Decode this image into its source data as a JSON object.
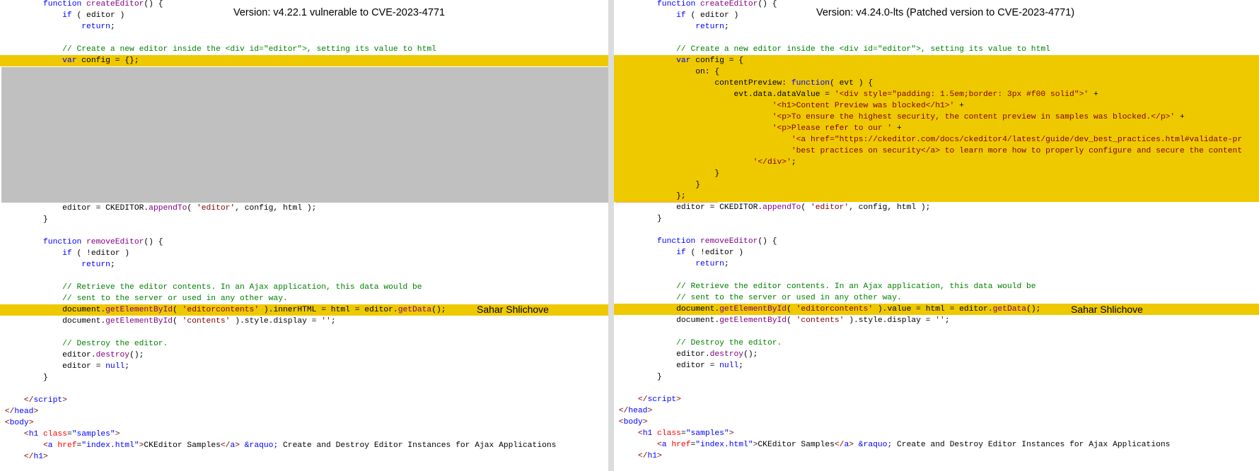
{
  "left_pane": {
    "banner": "Version: v4.22.1 vulnerable to CVE-2023-4771",
    "signature": "Sahar Shlichove",
    "lines": [
      {
        "indent": "        ",
        "tokens": [
          [
            "kw",
            "function "
          ],
          [
            "fn",
            "createEditor"
          ],
          [
            "plain",
            "() {"
          ]
        ]
      },
      {
        "indent": "            ",
        "tokens": [
          [
            "kw",
            "if "
          ],
          [
            "plain",
            "( editor )"
          ]
        ]
      },
      {
        "indent": "                ",
        "tokens": [
          [
            "kw",
            "return"
          ],
          [
            "plain",
            ";"
          ]
        ]
      },
      {
        "indent": "",
        "tokens": []
      },
      {
        "indent": "            ",
        "tokens": [
          [
            "cmt",
            "// Create a new editor inside the <div id=\"editor\">, setting its value to html"
          ]
        ]
      },
      {
        "indent": "            ",
        "tokens": [
          [
            "kw",
            "var "
          ],
          [
            "plain",
            "config = {};"
          ]
        ],
        "hl": "yellow"
      },
      {
        "indent": "            ",
        "tokens": [
          [
            "plain",
            "editor = "
          ],
          [
            "plain",
            "CKEDITOR."
          ],
          [
            "fn",
            "appendTo"
          ],
          [
            "plain",
            "( "
          ],
          [
            "str",
            "'editor'"
          ],
          [
            "plain",
            ", config, html );"
          ]
        ]
      },
      {
        "indent": "        ",
        "tokens": [
          [
            "plain",
            "}"
          ]
        ]
      },
      {
        "indent": "",
        "tokens": []
      },
      {
        "indent": "        ",
        "tokens": [
          [
            "kw",
            "function "
          ],
          [
            "fn",
            "removeEditor"
          ],
          [
            "plain",
            "() {"
          ]
        ]
      },
      {
        "indent": "            ",
        "tokens": [
          [
            "kw",
            "if "
          ],
          [
            "plain",
            "( !editor )"
          ]
        ]
      },
      {
        "indent": "                ",
        "tokens": [
          [
            "kw",
            "return"
          ],
          [
            "plain",
            ";"
          ]
        ]
      },
      {
        "indent": "",
        "tokens": []
      },
      {
        "indent": "            ",
        "tokens": [
          [
            "cmt",
            "// Retrieve the editor contents. In an Ajax application, this data would be"
          ]
        ]
      },
      {
        "indent": "            ",
        "tokens": [
          [
            "cmt",
            "// sent to the server or used in any other way."
          ]
        ]
      },
      {
        "indent": "            ",
        "tokens": [
          [
            "plain",
            "document."
          ],
          [
            "fn",
            "getElementById"
          ],
          [
            "plain",
            "( "
          ],
          [
            "str",
            "'editorcontents'"
          ],
          [
            "plain",
            " )."
          ],
          [
            "plain",
            "innerHTML"
          ],
          [
            "plain",
            " = html = editor."
          ],
          [
            "fn",
            "getData"
          ],
          [
            "plain",
            "();"
          ]
        ],
        "hl": "yellow"
      },
      {
        "indent": "            ",
        "tokens": [
          [
            "plain",
            "document."
          ],
          [
            "fn",
            "getElementById"
          ],
          [
            "plain",
            "( "
          ],
          [
            "str",
            "'contents'"
          ],
          [
            "plain",
            " ).style.display = "
          ],
          [
            "str",
            "''"
          ],
          [
            "plain",
            ";"
          ]
        ]
      },
      {
        "indent": "",
        "tokens": []
      },
      {
        "indent": "            ",
        "tokens": [
          [
            "cmt",
            "// Destroy the editor."
          ]
        ]
      },
      {
        "indent": "            ",
        "tokens": [
          [
            "plain",
            "editor."
          ],
          [
            "fn",
            "destroy"
          ],
          [
            "plain",
            "();"
          ]
        ]
      },
      {
        "indent": "            ",
        "tokens": [
          [
            "plain",
            "editor = "
          ],
          [
            "kw",
            "null"
          ],
          [
            "plain",
            ";"
          ]
        ]
      },
      {
        "indent": "        ",
        "tokens": [
          [
            "plain",
            "}"
          ]
        ]
      },
      {
        "indent": "",
        "tokens": []
      },
      {
        "indent": "    ",
        "tokens": [
          [
            "tag",
            "</"
          ],
          [
            "kw",
            "script"
          ],
          [
            "tag",
            ">"
          ]
        ]
      },
      {
        "indent": "",
        "tokens": [
          [
            "tag",
            "</"
          ],
          [
            "kw",
            "head"
          ],
          [
            "tag",
            ">"
          ]
        ]
      },
      {
        "indent": "",
        "tokens": [
          [
            "tag",
            "<"
          ],
          [
            "kw",
            "body"
          ],
          [
            "tag",
            ">"
          ]
        ]
      },
      {
        "indent": "    ",
        "tokens": [
          [
            "tag",
            "<"
          ],
          [
            "kw",
            "h1 "
          ],
          [
            "attr",
            "class"
          ],
          [
            "plain",
            "="
          ],
          [
            "val",
            "\"samples\""
          ],
          [
            "tag",
            ">"
          ]
        ]
      },
      {
        "indent": "        ",
        "tokens": [
          [
            "tag",
            "<"
          ],
          [
            "kw",
            "a "
          ],
          [
            "attr",
            "href"
          ],
          [
            "plain",
            "="
          ],
          [
            "val",
            "\"index.html\""
          ],
          [
            "tag",
            ">"
          ],
          [
            "plain",
            "CKEditor Samples"
          ],
          [
            "tag",
            "</"
          ],
          [
            "kw",
            "a"
          ],
          [
            "tag",
            ">"
          ],
          [
            "plain",
            " "
          ],
          [
            "ent",
            "&raquo;"
          ],
          [
            "plain",
            " Create and Destroy Editor Instances for Ajax Applications"
          ]
        ]
      },
      {
        "indent": "    ",
        "tokens": [
          [
            "tag",
            "</"
          ],
          [
            "kw",
            "h1"
          ],
          [
            "tag",
            ">"
          ]
        ]
      }
    ]
  },
  "right_pane": {
    "banner": "Version: v4.24.0-lts (Patched version to CVE-2023-4771)",
    "signature": "Sahar Shlichove",
    "lines": [
      {
        "indent": "        ",
        "tokens": [
          [
            "kw",
            "function "
          ],
          [
            "fn",
            "createEditor"
          ],
          [
            "plain",
            "() {"
          ]
        ]
      },
      {
        "indent": "            ",
        "tokens": [
          [
            "kw",
            "if "
          ],
          [
            "plain",
            "( editor )"
          ]
        ]
      },
      {
        "indent": "                ",
        "tokens": [
          [
            "kw",
            "return"
          ],
          [
            "plain",
            ";"
          ]
        ]
      },
      {
        "indent": "",
        "tokens": []
      },
      {
        "indent": "            ",
        "tokens": [
          [
            "cmt",
            "// Create a new editor inside the <div id=\"editor\">, setting its value to html"
          ]
        ]
      },
      {
        "indent": "            ",
        "tokens": [
          [
            "kw",
            "var "
          ],
          [
            "plain",
            "config = {"
          ]
        ],
        "hl": "yellow"
      },
      {
        "indent": "                ",
        "tokens": [
          [
            "plain",
            "on: {"
          ]
        ],
        "hl": "yellow"
      },
      {
        "indent": "                    ",
        "tokens": [
          [
            "plain",
            "contentPreview: "
          ],
          [
            "kw",
            "function"
          ],
          [
            "plain",
            "( evt ) {"
          ]
        ],
        "hl": "yellow"
      },
      {
        "indent": "                        ",
        "tokens": [
          [
            "plain",
            "evt.data.dataValue = "
          ],
          [
            "str",
            "'<div style=\"padding: 1.5em;border: 3px #f00 solid\">'"
          ],
          [
            "plain",
            " +"
          ]
        ],
        "hl": "yellow"
      },
      {
        "indent": "                                ",
        "tokens": [
          [
            "str",
            "'<h1>Content Preview was blocked</h1>'"
          ],
          [
            "plain",
            " +"
          ]
        ],
        "hl": "yellow"
      },
      {
        "indent": "                                ",
        "tokens": [
          [
            "str",
            "'<p>To ensure the highest security, the content preview in samples was blocked.</p>'"
          ],
          [
            "plain",
            " +"
          ]
        ],
        "hl": "yellow"
      },
      {
        "indent": "                                ",
        "tokens": [
          [
            "str",
            "'<p>Please refer to our '"
          ],
          [
            "plain",
            " +"
          ]
        ],
        "hl": "yellow"
      },
      {
        "indent": "                                    ",
        "tokens": [
          [
            "str",
            "'<a href=\"https://ckeditor.com/docs/ckeditor4/latest/guide/dev_best_practices.html#validate-pr"
          ]
        ],
        "hl": "yellow"
      },
      {
        "indent": "                                    ",
        "tokens": [
          [
            "str",
            "'best practices on security</a> to learn more how to properly configure and secure the content"
          ]
        ],
        "hl": "yellow"
      },
      {
        "indent": "                            ",
        "tokens": [
          [
            "str",
            "'</div>'"
          ],
          [
            "plain",
            ";"
          ]
        ],
        "hl": "yellow"
      },
      {
        "indent": "                    ",
        "tokens": [
          [
            "plain",
            "}"
          ]
        ],
        "hl": "yellow"
      },
      {
        "indent": "                ",
        "tokens": [
          [
            "plain",
            "}"
          ]
        ],
        "hl": "yellow"
      },
      {
        "indent": "            ",
        "tokens": [
          [
            "plain",
            "};"
          ]
        ],
        "hl": "yellow"
      },
      {
        "indent": "            ",
        "tokens": [
          [
            "plain",
            "editor = "
          ],
          [
            "plain",
            "CKEDITOR."
          ],
          [
            "fn",
            "appendTo"
          ],
          [
            "plain",
            "( "
          ],
          [
            "str",
            "'editor'"
          ],
          [
            "plain",
            ", config, html );"
          ]
        ]
      },
      {
        "indent": "        ",
        "tokens": [
          [
            "plain",
            "}"
          ]
        ]
      },
      {
        "indent": "",
        "tokens": []
      },
      {
        "indent": "        ",
        "tokens": [
          [
            "kw",
            "function "
          ],
          [
            "fn",
            "removeEditor"
          ],
          [
            "plain",
            "() {"
          ]
        ]
      },
      {
        "indent": "            ",
        "tokens": [
          [
            "kw",
            "if "
          ],
          [
            "plain",
            "( !editor )"
          ]
        ]
      },
      {
        "indent": "                ",
        "tokens": [
          [
            "kw",
            "return"
          ],
          [
            "plain",
            ";"
          ]
        ]
      },
      {
        "indent": "",
        "tokens": []
      },
      {
        "indent": "            ",
        "tokens": [
          [
            "cmt",
            "// Retrieve the editor contents. In an Ajax application, this data would be"
          ]
        ]
      },
      {
        "indent": "            ",
        "tokens": [
          [
            "cmt",
            "// sent to the server or used in any other way."
          ]
        ]
      },
      {
        "indent": "            ",
        "tokens": [
          [
            "plain",
            "document."
          ],
          [
            "fn",
            "getElementById"
          ],
          [
            "plain",
            "( "
          ],
          [
            "str",
            "'editorcontents'"
          ],
          [
            "plain",
            " )."
          ],
          [
            "plain",
            "value"
          ],
          [
            "plain",
            " = html = editor."
          ],
          [
            "fn",
            "getData"
          ],
          [
            "plain",
            "();"
          ]
        ],
        "hl": "yellow"
      },
      {
        "indent": "            ",
        "tokens": [
          [
            "plain",
            "document."
          ],
          [
            "fn",
            "getElementById"
          ],
          [
            "plain",
            "( "
          ],
          [
            "str",
            "'contents'"
          ],
          [
            "plain",
            " ).style.display = "
          ],
          [
            "str",
            "''"
          ],
          [
            "plain",
            ";"
          ]
        ]
      },
      {
        "indent": "",
        "tokens": []
      },
      {
        "indent": "            ",
        "tokens": [
          [
            "cmt",
            "// Destroy the editor."
          ]
        ]
      },
      {
        "indent": "            ",
        "tokens": [
          [
            "plain",
            "editor."
          ],
          [
            "fn",
            "destroy"
          ],
          [
            "plain",
            "();"
          ]
        ]
      },
      {
        "indent": "            ",
        "tokens": [
          [
            "plain",
            "editor = "
          ],
          [
            "kw",
            "null"
          ],
          [
            "plain",
            ";"
          ]
        ]
      },
      {
        "indent": "        ",
        "tokens": [
          [
            "plain",
            "}"
          ]
        ]
      },
      {
        "indent": "",
        "tokens": []
      },
      {
        "indent": "    ",
        "tokens": [
          [
            "tag",
            "</"
          ],
          [
            "kw",
            "script"
          ],
          [
            "tag",
            ">"
          ]
        ]
      },
      {
        "indent": "",
        "tokens": [
          [
            "tag",
            "</"
          ],
          [
            "kw",
            "head"
          ],
          [
            "tag",
            ">"
          ]
        ]
      },
      {
        "indent": "",
        "tokens": [
          [
            "tag",
            "<"
          ],
          [
            "kw",
            "body"
          ],
          [
            "tag",
            ">"
          ]
        ]
      },
      {
        "indent": "    ",
        "tokens": [
          [
            "tag",
            "<"
          ],
          [
            "kw",
            "h1 "
          ],
          [
            "attr",
            "class"
          ],
          [
            "plain",
            "="
          ],
          [
            "val",
            "\"samples\""
          ],
          [
            "tag",
            ">"
          ]
        ]
      },
      {
        "indent": "        ",
        "tokens": [
          [
            "tag",
            "<"
          ],
          [
            "kw",
            "a "
          ],
          [
            "attr",
            "href"
          ],
          [
            "plain",
            "="
          ],
          [
            "val",
            "\"index.html\""
          ],
          [
            "tag",
            ">"
          ],
          [
            "plain",
            "CKEditor Samples"
          ],
          [
            "tag",
            "</"
          ],
          [
            "kw",
            "a"
          ],
          [
            "tag",
            ">"
          ],
          [
            "plain",
            " "
          ],
          [
            "ent",
            "&raquo;"
          ],
          [
            "plain",
            " Create and Destroy Editor Instances for Ajax Applications"
          ]
        ]
      },
      {
        "indent": "    ",
        "tokens": [
          [
            "tag",
            "</"
          ],
          [
            "kw",
            "h1"
          ],
          [
            "tag",
            ">"
          ]
        ]
      }
    ]
  },
  "colors": {
    "highlight_yellow": "#efc900",
    "highlight_gray": "#c0c0c0",
    "highlight_salmon": "#f9a882",
    "keyword": "#0000ff",
    "function": "#800080",
    "string": "#800000",
    "comment": "#008000"
  }
}
